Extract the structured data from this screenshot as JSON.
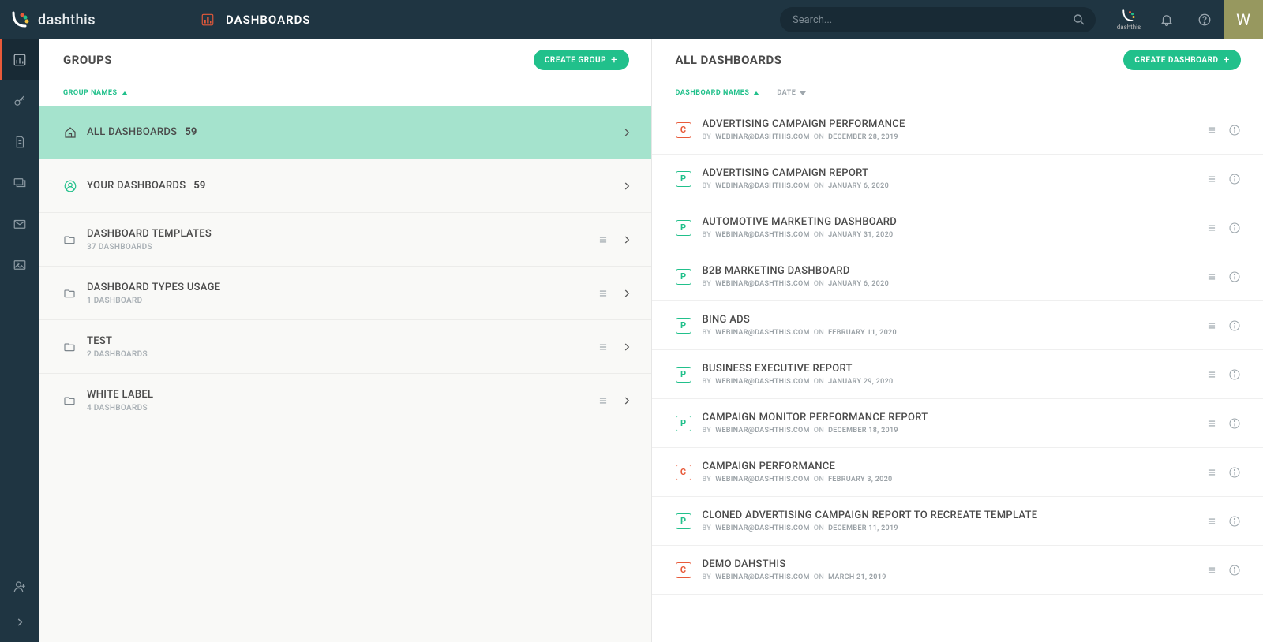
{
  "header": {
    "brand": "dashthis",
    "title": "DASHBOARDS",
    "search_placeholder": "Search...",
    "avatar_initial": "W",
    "mini_brand": "dashthis"
  },
  "groups_panel": {
    "title": "GROUPS",
    "create_label": "CREATE GROUP",
    "sort_label": "GROUP NAMES",
    "items": [
      {
        "icon": "home",
        "title": "ALL DASHBOARDS",
        "count": "59",
        "sub": "",
        "selected": true,
        "has_menu": false,
        "you": false
      },
      {
        "icon": "user",
        "title": "YOUR DASHBOARDS",
        "count": "59",
        "sub": "",
        "selected": false,
        "has_menu": false,
        "you": true,
        "divider_after": true
      },
      {
        "icon": "folder",
        "title": "DASHBOARD TEMPLATES",
        "count": "",
        "sub": "37 DASHBOARDS",
        "selected": false,
        "has_menu": true
      },
      {
        "icon": "folder",
        "title": "DASHBOARD TYPES USAGE",
        "count": "",
        "sub": "1 DASHBOARD",
        "selected": false,
        "has_menu": true
      },
      {
        "icon": "folder",
        "title": "TEST",
        "count": "",
        "sub": "2 DASHBOARDS",
        "selected": false,
        "has_menu": true
      },
      {
        "icon": "folder",
        "title": "WHITE LABEL",
        "count": "",
        "sub": "4 DASHBOARDS",
        "selected": false,
        "has_menu": true
      }
    ]
  },
  "dash_panel": {
    "title": "ALL DASHBOARDS",
    "create_label": "CREATE DASHBOARD",
    "sort_name": "DASHBOARD NAMES",
    "sort_date": "DATE",
    "by_label": "BY",
    "on_label": "ON",
    "items": [
      {
        "badge": "C",
        "title": "ADVERTISING CAMPAIGN PERFORMANCE",
        "by": "WEBINAR@DASHTHIS.COM",
        "on": "DECEMBER 28, 2019"
      },
      {
        "badge": "P",
        "title": "ADVERTISING CAMPAIGN REPORT",
        "by": "WEBINAR@DASHTHIS.COM",
        "on": "JANUARY 6, 2020"
      },
      {
        "badge": "P",
        "title": "AUTOMOTIVE MARKETING DASHBOARD",
        "by": "WEBINAR@DASHTHIS.COM",
        "on": "JANUARY 31, 2020"
      },
      {
        "badge": "P",
        "title": "B2B MARKETING DASHBOARD",
        "by": "WEBINAR@DASHTHIS.COM",
        "on": "JANUARY 6, 2020"
      },
      {
        "badge": "P",
        "title": "BING ADS",
        "by": "WEBINAR@DASHTHIS.COM",
        "on": "FEBRUARY 11, 2020"
      },
      {
        "badge": "P",
        "title": "BUSINESS EXECUTIVE REPORT",
        "by": "WEBINAR@DASHTHIS.COM",
        "on": "JANUARY 29, 2020"
      },
      {
        "badge": "P",
        "title": "CAMPAIGN MONITOR PERFORMANCE REPORT",
        "by": "WEBINAR@DASHTHIS.COM",
        "on": "DECEMBER 18, 2019"
      },
      {
        "badge": "C",
        "title": "CAMPAIGN PERFORMANCE",
        "by": "WEBINAR@DASHTHIS.COM",
        "on": "FEBRUARY 3, 2020"
      },
      {
        "badge": "P",
        "title": "CLONED ADVERTISING CAMPAIGN REPORT TO RECREATE TEMPLATE",
        "by": "WEBINAR@DASHTHIS.COM",
        "on": "DECEMBER 11, 2019"
      },
      {
        "badge": "C",
        "title": "DEMO DAHSTHIS",
        "by": "WEBINAR@DASHTHIS.COM",
        "on": "MARCH 21, 2019"
      }
    ]
  }
}
